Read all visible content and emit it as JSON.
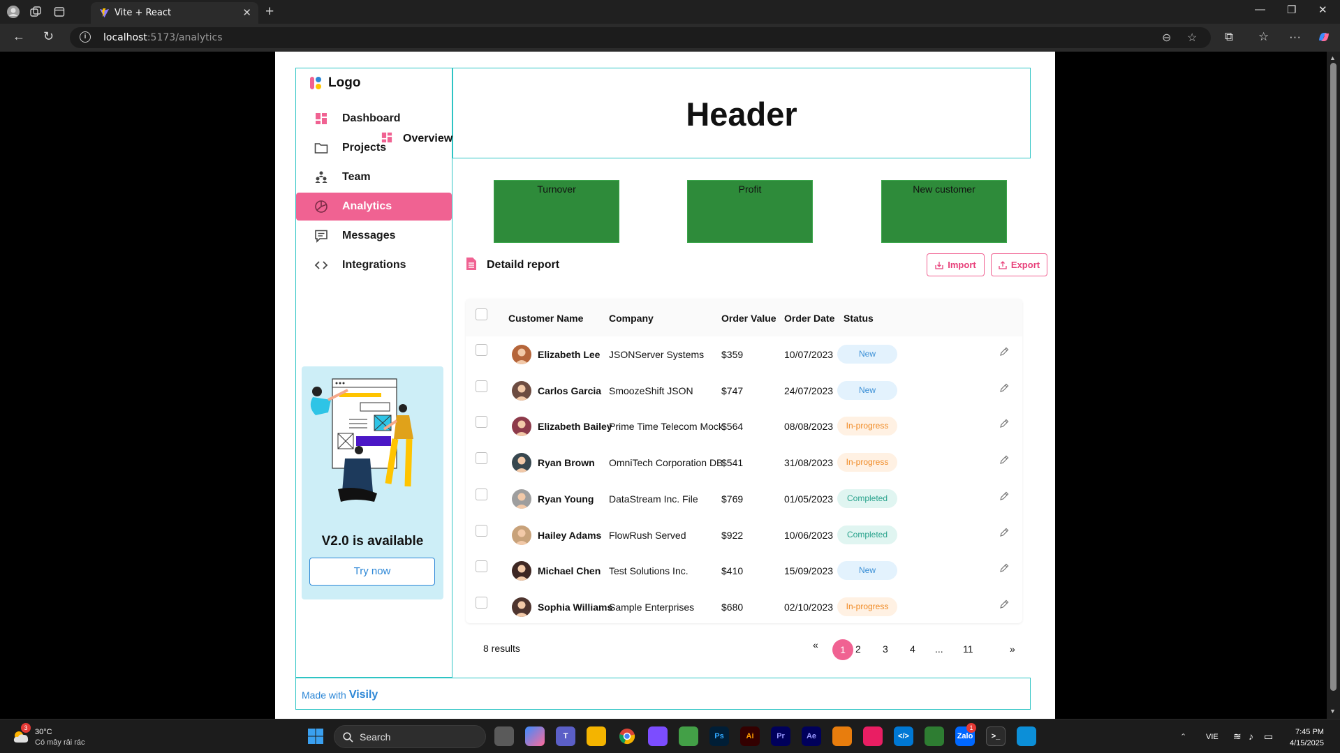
{
  "browser": {
    "tab_title": "Vite + React",
    "url_host": "localhost",
    "url_path": ":5173/analytics"
  },
  "sidebar": {
    "logo": "Logo",
    "items": [
      {
        "label": "Dashboard",
        "icon": "dashboard-icon"
      },
      {
        "label": "Projects",
        "icon": "folder-icon"
      },
      {
        "label": "Team",
        "icon": "team-icon"
      },
      {
        "label": "Analytics",
        "icon": "pie-chart-icon",
        "active": true
      },
      {
        "label": "Messages",
        "icon": "message-icon"
      },
      {
        "label": "Integrations",
        "icon": "code-icon"
      }
    ],
    "promo": {
      "title": "V2.0 is available",
      "button": "Try now"
    }
  },
  "header": {
    "title": "Header"
  },
  "overview": {
    "title": "Overview",
    "cards": [
      "Turnover",
      "Profit",
      "New customer"
    ]
  },
  "report": {
    "title": "Detaild report",
    "import_label": "Import",
    "export_label": "Export",
    "columns": [
      "Customer Name",
      "Company",
      "Order Value",
      "Order Date",
      "Status"
    ],
    "rows": [
      {
        "name": "Elizabeth Lee",
        "company": "JSONServer Systems",
        "value": "$359",
        "date": "10/07/2023",
        "status": "New"
      },
      {
        "name": "Carlos Garcia",
        "company": "SmoozeShift JSON",
        "value": "$747",
        "date": "24/07/2023",
        "status": "New"
      },
      {
        "name": "Elizabeth Bailey",
        "company": "Prime Time Telecom Mock",
        "value": "$564",
        "date": "08/08/2023",
        "status": "In-progress"
      },
      {
        "name": "Ryan Brown",
        "company": "OmniTech Corporation DB",
        "value": "$541",
        "date": "31/08/2023",
        "status": "In-progress"
      },
      {
        "name": "Ryan Young",
        "company": "DataStream Inc. File",
        "value": "$769",
        "date": "01/05/2023",
        "status": "Completed"
      },
      {
        "name": "Hailey Adams",
        "company": "FlowRush Served",
        "value": "$922",
        "date": "10/06/2023",
        "status": "Completed"
      },
      {
        "name": "Michael Chen",
        "company": "Test Solutions Inc.",
        "value": "$410",
        "date": "15/09/2023",
        "status": "New"
      },
      {
        "name": "Sophia Williams",
        "company": "Sample Enterprises",
        "value": "$680",
        "date": "02/10/2023",
        "status": "In-progress"
      }
    ],
    "results": "8 results",
    "pagination": {
      "prev": "«",
      "pages": [
        "1",
        "2",
        "3",
        "4",
        "...",
        "11"
      ],
      "current": "1",
      "next": "»"
    }
  },
  "footer": {
    "made_with": "Made with",
    "brand": "Visily"
  },
  "status_colors": {
    "New": {
      "bg": "#e3f2fd",
      "fg": "#3a8fd6"
    },
    "In-progress": {
      "bg": "#fff1e3",
      "fg": "#f08a24"
    },
    "Completed": {
      "bg": "#e0f5f1",
      "fg": "#2aa38d"
    }
  },
  "accent_color": "#f06292",
  "taskbar": {
    "weather_temp": "30°C",
    "weather_desc": "Có mây rải rác",
    "weather_badge": "3",
    "search": "Search",
    "lang": "VIE",
    "time": "7:45 PM",
    "date": "4/15/2025",
    "zalo_badge": "1"
  }
}
